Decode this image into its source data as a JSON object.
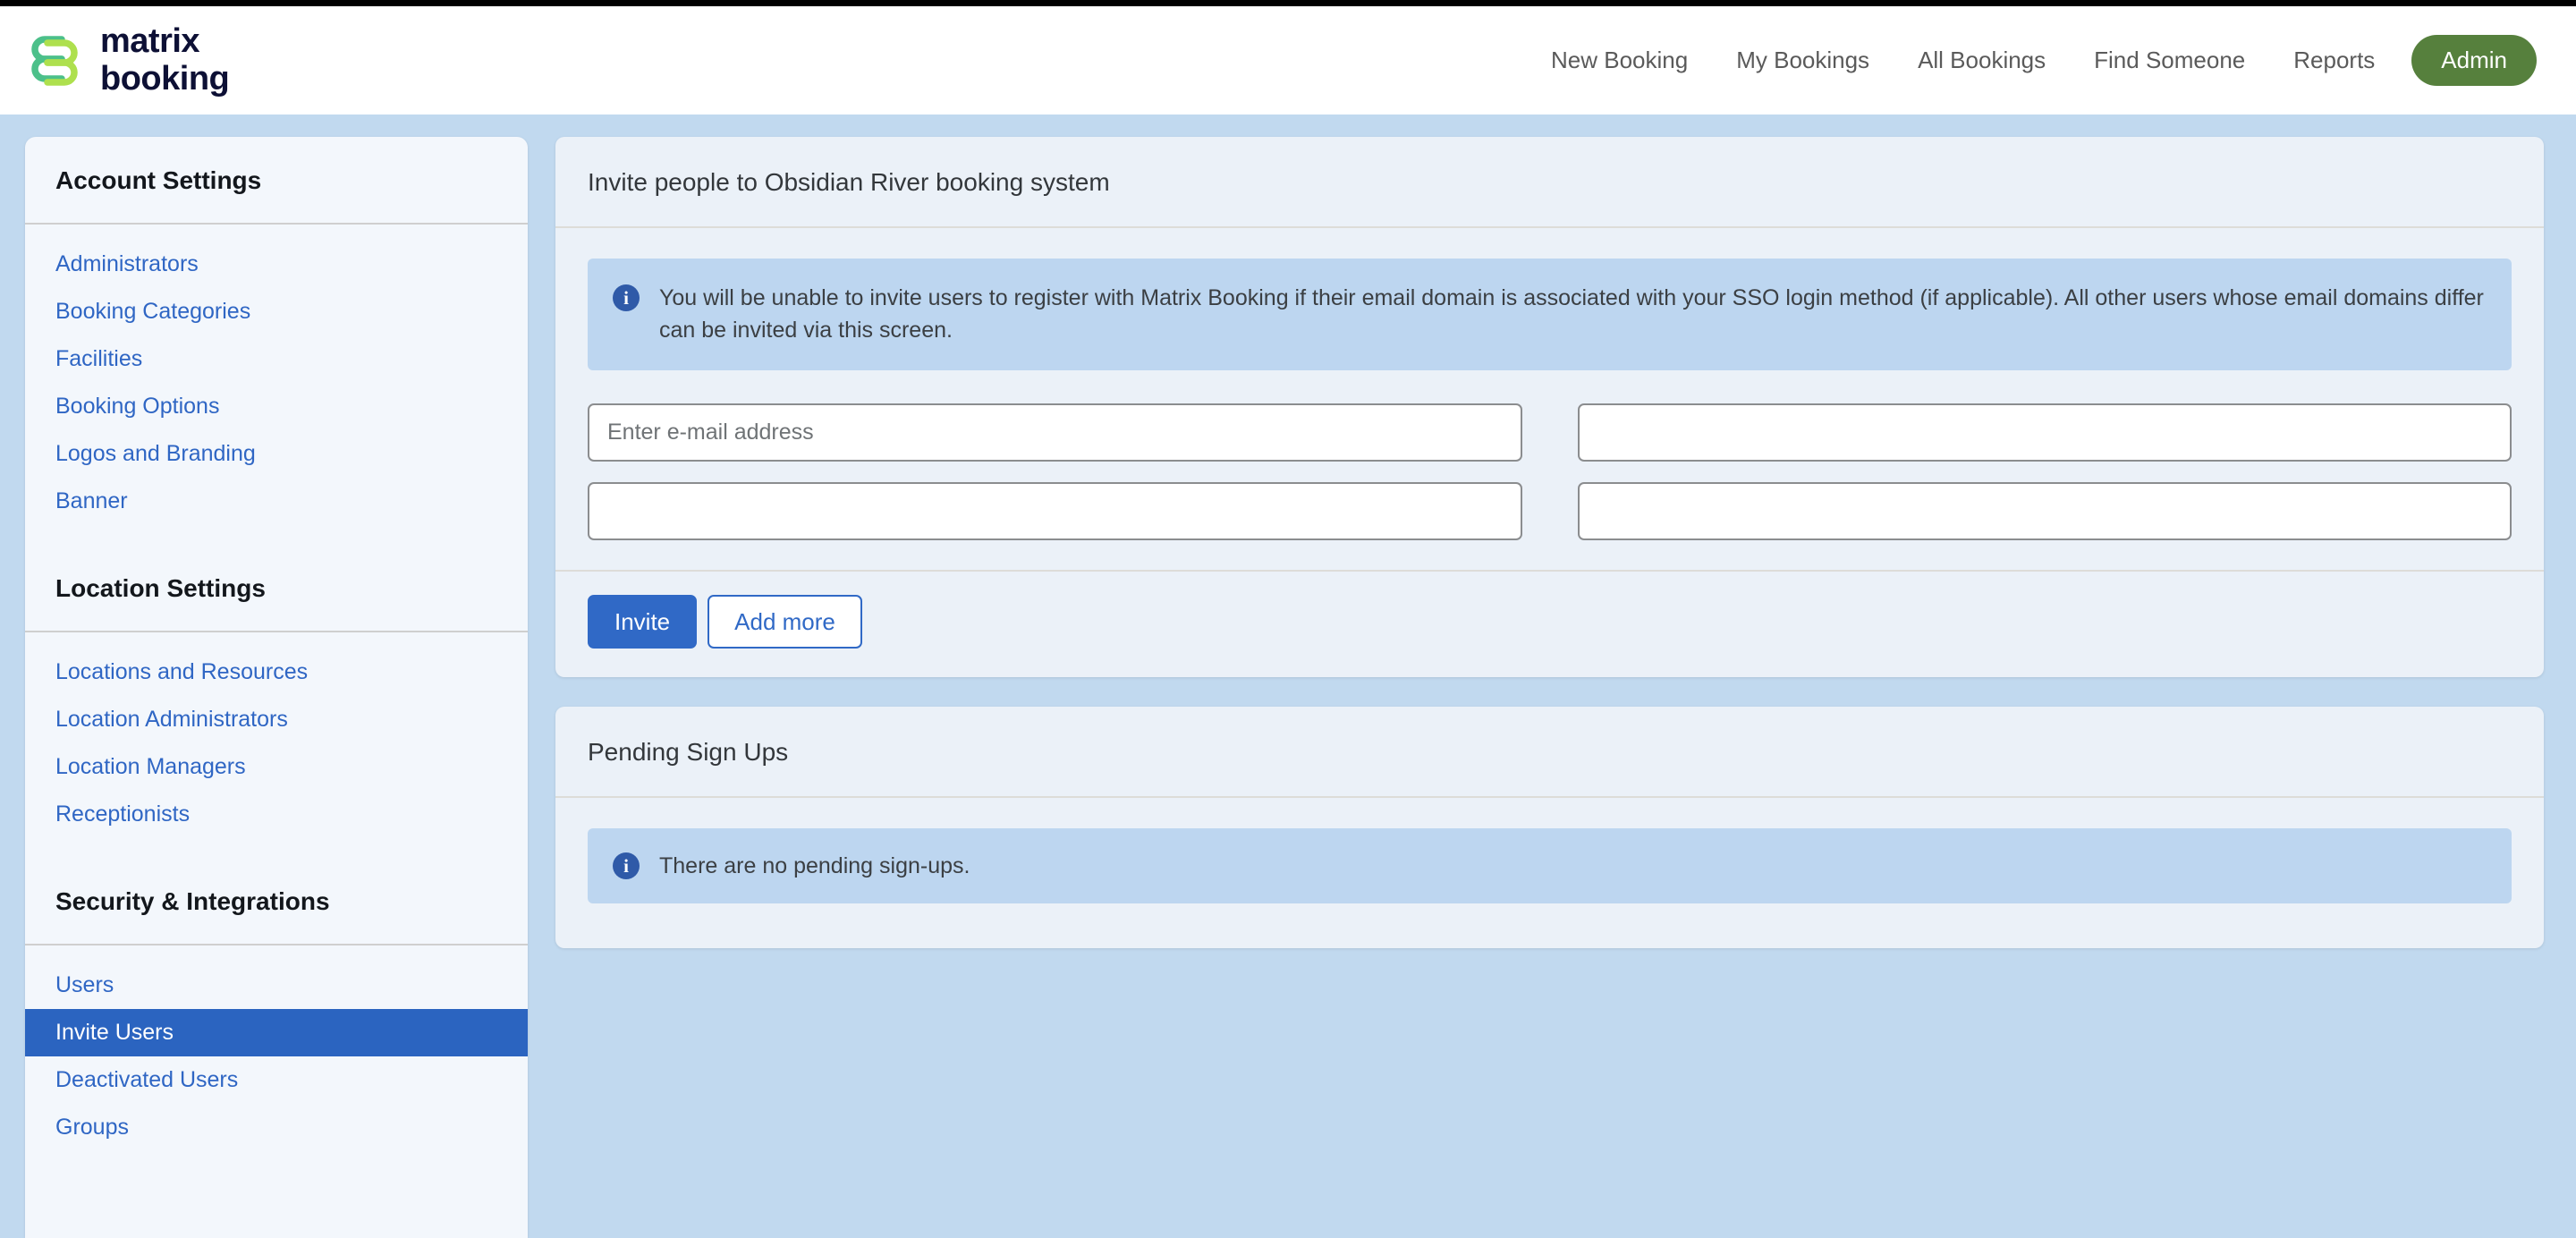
{
  "brand": {
    "name_line1": "matrix",
    "name_line2": "booking",
    "logo_icon": "matrix-booking-logo",
    "green_dark": "#4cc08a",
    "green_light": "#aee04e",
    "text_color": "#0d1035"
  },
  "header": {
    "nav": [
      {
        "label": "New Booking",
        "name": "nav-new-booking"
      },
      {
        "label": "My Bookings",
        "name": "nav-my-bookings"
      },
      {
        "label": "All Bookings",
        "name": "nav-all-bookings"
      },
      {
        "label": "Find Someone",
        "name": "nav-find-someone"
      },
      {
        "label": "Reports",
        "name": "nav-reports"
      }
    ],
    "admin_label": "Admin",
    "admin_color": "#56803d"
  },
  "sidebar": {
    "sections": [
      {
        "heading": "Account Settings",
        "items": [
          {
            "label": "Administrators",
            "active": false
          },
          {
            "label": "Booking Categories",
            "active": false
          },
          {
            "label": "Facilities",
            "active": false
          },
          {
            "label": "Booking Options",
            "active": false
          },
          {
            "label": "Logos and Branding",
            "active": false
          },
          {
            "label": "Banner",
            "active": false
          }
        ]
      },
      {
        "heading": "Location Settings",
        "items": [
          {
            "label": "Locations and Resources",
            "active": false
          },
          {
            "label": "Location Administrators",
            "active": false
          },
          {
            "label": "Location Managers",
            "active": false
          },
          {
            "label": "Receptionists",
            "active": false
          }
        ]
      },
      {
        "heading": "Security & Integrations",
        "items": [
          {
            "label": "Users",
            "active": false
          },
          {
            "label": "Invite Users",
            "active": true
          },
          {
            "label": "Deactivated Users",
            "active": false
          },
          {
            "label": "Groups",
            "active": false
          }
        ]
      }
    ],
    "active_item": "Invite Users",
    "active_color": "#2b64c0",
    "link_color": "#2f66c4"
  },
  "invite_card": {
    "title": "Invite people to Obsidian River booking system",
    "alert": {
      "icon": "info-icon",
      "text": "You will be unable to invite users to register with Matrix Booking if their email domain is associated with your SSO login method (if applicable). All other users whose email domains differ can be invited via this screen."
    },
    "fields": [
      {
        "name": "email-field-1",
        "value": "",
        "placeholder": "Enter e-mail address"
      },
      {
        "name": "email-field-2",
        "value": "",
        "placeholder": ""
      },
      {
        "name": "email-field-3",
        "value": "",
        "placeholder": ""
      },
      {
        "name": "email-field-4",
        "value": "",
        "placeholder": ""
      }
    ],
    "invite_label": "Invite",
    "add_more_label": "Add more",
    "primary_color": "#3069c6"
  },
  "pending_card": {
    "title": "Pending Sign Ups",
    "alert": {
      "icon": "info-icon",
      "text": "There are no pending sign-ups."
    }
  }
}
